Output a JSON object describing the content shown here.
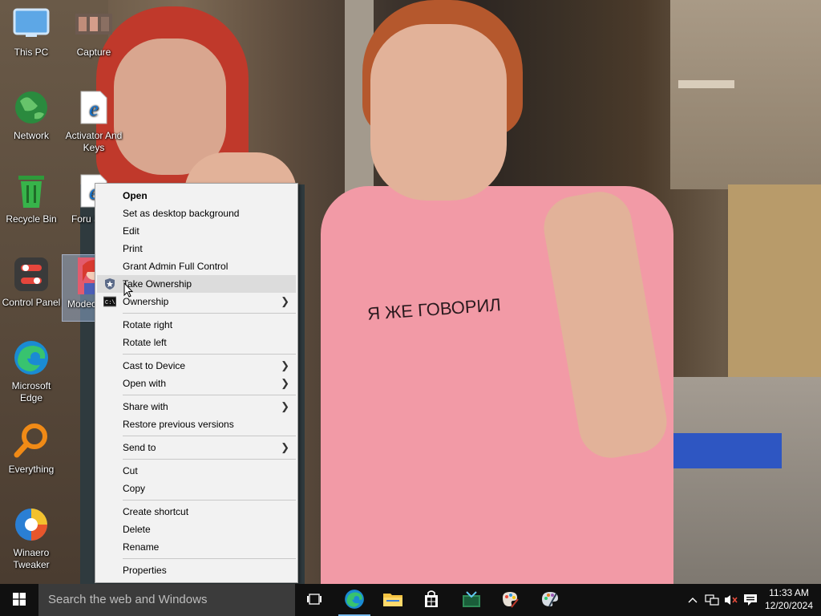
{
  "desktop": {
    "icons": [
      {
        "label": "This PC",
        "icon": "this-pc-icon"
      },
      {
        "label": "Capture",
        "icon": "image-thumbnail-icon"
      },
      {
        "label": "Network",
        "icon": "network-globe-icon"
      },
      {
        "label": "Activator And Keys",
        "icon": "edge-document-icon"
      },
      {
        "label": "Recycle Bin",
        "icon": "recycle-bin-icon"
      },
      {
        "label": "Forum Support",
        "label_visible": "Foru Supp",
        "icon": "edge-document-icon"
      },
      {
        "label": "Control Panel",
        "icon": "control-panel-icon"
      },
      {
        "label": "Modecp_ap",
        "label_visible": "Modec p_ap",
        "icon": "anime-image-icon"
      },
      {
        "label": "Microsoft Edge",
        "icon": "edge-icon"
      },
      {
        "label": "Everything",
        "icon": "everything-search-icon"
      },
      {
        "label": "Winaero Tweaker",
        "icon": "winaero-tweaker-icon"
      }
    ]
  },
  "wallpaper": {
    "shirt_text": "Я ЖЕ ГОВОРИЛ"
  },
  "context_menu": {
    "items": [
      {
        "label": "Open",
        "bold": true
      },
      {
        "label": "Set as desktop background"
      },
      {
        "label": "Edit"
      },
      {
        "label": "Print"
      },
      {
        "label": "Grant Admin Full Control"
      },
      {
        "label": "Take Ownership",
        "icon": "shield-icon",
        "hover": true
      },
      {
        "label": "Ownership",
        "icon": "cmd-icon",
        "submenu": true
      },
      {
        "label": "Rotate right"
      },
      {
        "label": "Rotate left"
      },
      {
        "label": "Cast to Device",
        "submenu": true
      },
      {
        "label": "Open with",
        "submenu": true
      },
      {
        "label": "Share with",
        "submenu": true
      },
      {
        "label": "Restore previous versions"
      },
      {
        "label": "Send to",
        "submenu": true
      },
      {
        "label": "Cut"
      },
      {
        "label": "Copy"
      },
      {
        "label": "Create shortcut"
      },
      {
        "label": "Delete"
      },
      {
        "label": "Rename"
      },
      {
        "label": "Properties"
      }
    ]
  },
  "taskbar": {
    "search_placeholder": "Search the web and Windows",
    "apps": [
      "task-view-icon",
      "edge-icon",
      "file-explorer-icon",
      "store-icon",
      "screenshot-tool-icon",
      "paint-icon",
      "paint-palette-icon"
    ],
    "tray": [
      "chevron-up-icon",
      "network-icon",
      "volume-muted-icon",
      "action-center-icon"
    ],
    "time": "11:33 AM",
    "date": "12/20/2024"
  },
  "colors": {
    "taskbar": "#101010",
    "menu_bg": "#f2f2f2",
    "hover": "#dcdcdc",
    "accent": "#76b9ed"
  }
}
